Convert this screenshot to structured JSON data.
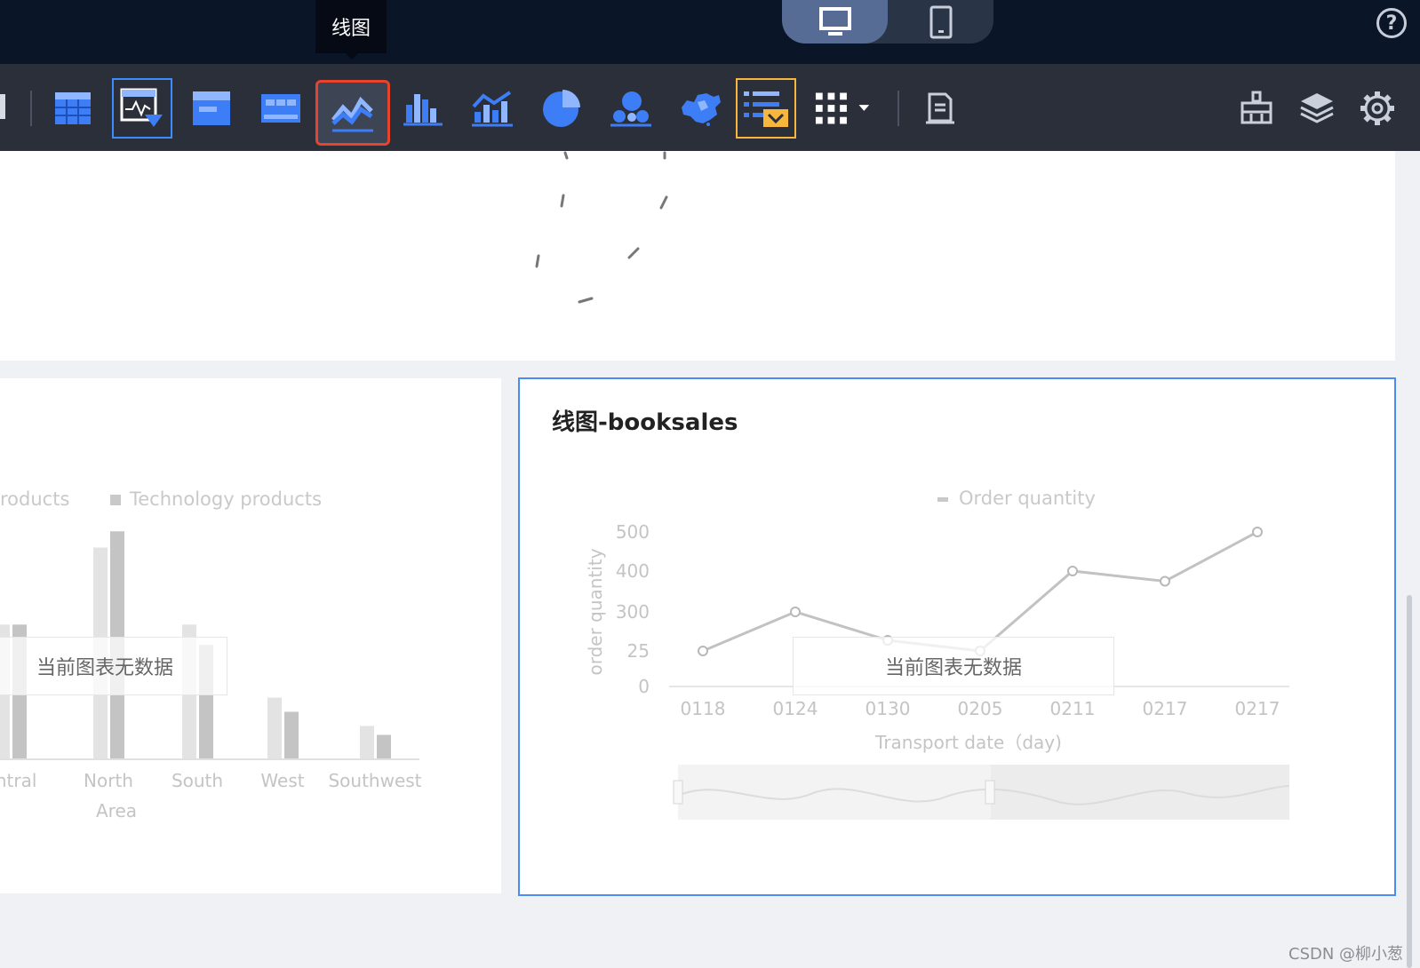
{
  "topbar": {
    "device_icons": [
      "desktop-icon",
      "mobile-icon"
    ],
    "active_device": "desktop",
    "help_icon": "help-icon",
    "help_glyph": "?"
  },
  "tooltip": {
    "text": "线图"
  },
  "toolbar": {
    "items": [
      "table-icon",
      "cross-table-icon",
      "card-icon",
      "indicator-card-icon",
      "line-chart-icon",
      "bar-chart-icon",
      "combo-chart-icon",
      "pie-chart-icon",
      "scatter-chart-icon",
      "map-icon",
      "filter-list-icon",
      "more-charts-icon",
      "report-icon",
      "brush-icon",
      "layers-icon",
      "settings-icon"
    ],
    "selected": "line-chart-icon"
  },
  "left_panel": {
    "legend_partial": "roducts",
    "legend_tech": "Technology products",
    "no_data": "当前图表无数据",
    "chart_data": {
      "type": "bar",
      "categories": [
        "entral",
        "North",
        "South",
        "West",
        "Southwest"
      ],
      "xlabel": "Area",
      "series": [
        {
          "name": "roducts",
          "values": [
            330,
            520,
            330,
            150,
            80
          ]
        },
        {
          "name": "Technology products",
          "values": [
            330,
            560,
            280,
            115,
            58
          ]
        }
      ],
      "ylim": [
        0,
        600
      ]
    }
  },
  "right_panel": {
    "title": "线图-booksales",
    "legend": "Order quantity",
    "no_data": "当前图表无数据",
    "chart_data": {
      "type": "line",
      "title": "线图-booksales",
      "xlabel": "Transport date（day)",
      "ylabel": "order quantity",
      "y_ticks": [
        "500",
        "400",
        "300",
        "25",
        "0"
      ],
      "categories": [
        "0118",
        "0124",
        "0130",
        "0205",
        "0211",
        "0217",
        "0217"
      ],
      "series": [
        {
          "name": "Order quantity",
          "values": [
            25,
            300,
            100,
            25,
            400,
            375,
            500
          ]
        }
      ]
    }
  },
  "watermark": "CSDN @柳小葱"
}
